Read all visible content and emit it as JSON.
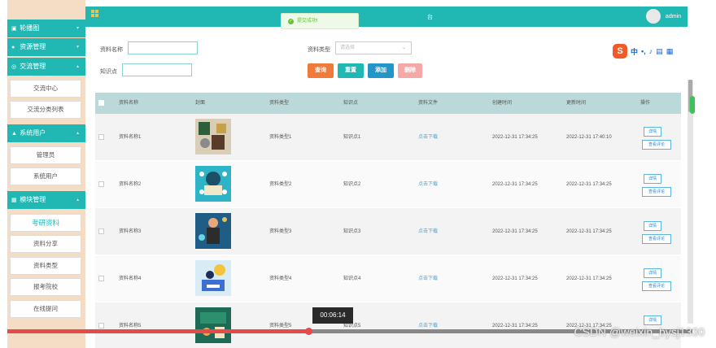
{
  "sidebar": {
    "menus": [
      {
        "label": "轮播图",
        "icon": "image-icon"
      },
      {
        "label": "资源管理",
        "icon": "folder-icon"
      },
      {
        "label": "交流管理",
        "icon": "chat-icon"
      },
      {
        "label": "系统用户",
        "icon": "user-icon"
      },
      {
        "label": "模块管理",
        "icon": "module-icon"
      }
    ],
    "subs": [
      {
        "label": "交流中心"
      },
      {
        "label": "交流分类列表"
      },
      {
        "label": "管理员"
      },
      {
        "label": "系统用户"
      },
      {
        "label": "考研资料"
      },
      {
        "label": "资料分享"
      },
      {
        "label": "资料类型"
      },
      {
        "label": "报考院校"
      },
      {
        "label": "在线提问"
      }
    ]
  },
  "header": {
    "title_fragment": "台",
    "user": "admin"
  },
  "toast": "提交成功!",
  "search": {
    "name_label": "资料名称",
    "type_label": "资料类型",
    "type_placeholder": "请选择",
    "knowledge_label": "知识点"
  },
  "buttons": {
    "query": "查询",
    "reset": "重置",
    "add": "添加",
    "delete": "删除"
  },
  "ime": {
    "lang": "中"
  },
  "table": {
    "headers": [
      "资料名称",
      "封面",
      "资料类型",
      "知识点",
      "资料文件",
      "创建时间",
      "更新时间",
      "操作"
    ],
    "rows": [
      {
        "name": "资料名称1",
        "type": "资料类型1",
        "knowledge": "知识点1",
        "file": "点击下载",
        "created": "2022-12-31 17:34:25",
        "updated": "2022-12-31 17:40:10"
      },
      {
        "name": "资料名称2",
        "type": "资料类型2",
        "knowledge": "知识点2",
        "file": "点击下载",
        "created": "2022-12-31 17:34:25",
        "updated": "2022-12-31 17:34:25"
      },
      {
        "name": "资料名称3",
        "type": "资料类型3",
        "knowledge": "知识点3",
        "file": "点击下载",
        "created": "2022-12-31 17:34:25",
        "updated": "2022-12-31 17:34:25"
      },
      {
        "name": "资料名称4",
        "type": "资料类型4",
        "knowledge": "知识点4",
        "file": "点击下载",
        "created": "2022-12-31 17:34:25",
        "updated": "2022-12-31 17:34:25"
      },
      {
        "name": "资料名称5",
        "type": "资料类型5",
        "knowledge": "知识点5",
        "file": "点击下载",
        "created": "2022-12-31 17:34:25",
        "updated": "2022-12-31 17:34:25"
      }
    ],
    "action_detail": "详情",
    "action_comment": "查看评论"
  },
  "video": {
    "timestamp": "00:06:14",
    "progress": 0.44
  },
  "watermark": "CSDN @weixin_bysj1330",
  "colors": {
    "accent": "#21b8b4",
    "query_btn": "#f07a3a",
    "reset_btn": "#21b8b4",
    "add_btn": "#2296c8",
    "delete_btn": "#f4a8a8",
    "sidebar_bg": "#f5dcc4"
  }
}
